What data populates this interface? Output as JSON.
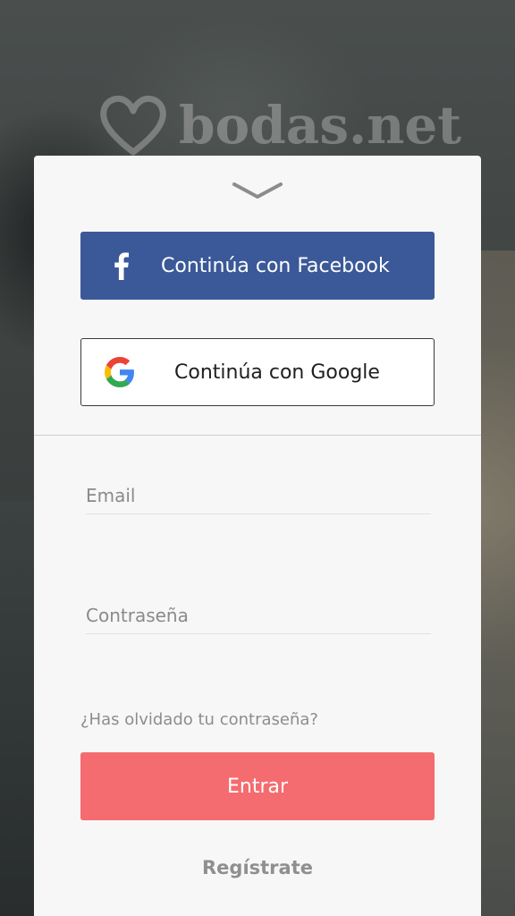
{
  "brand": {
    "logo_text": "bodas.net",
    "logo_icon": "heart-icon"
  },
  "login": {
    "collapse_icon": "chevron-down-icon",
    "facebook": {
      "icon": "facebook-icon",
      "label": "Continúa con Facebook",
      "color": "#3b5998"
    },
    "google": {
      "icon": "google-icon",
      "label": "Continúa con Google"
    },
    "email": {
      "placeholder": "Email",
      "value": ""
    },
    "password": {
      "placeholder": "Contraseña",
      "value": ""
    },
    "forgot_password": "¿Has olvidado tu contraseña?",
    "submit": {
      "label": "Entrar",
      "color": "#f46c6f"
    },
    "register": "Regístrate"
  }
}
